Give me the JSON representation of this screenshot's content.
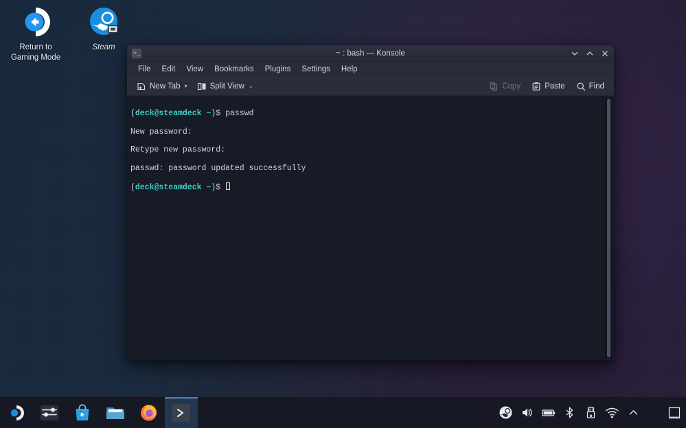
{
  "desktop": {
    "icons": [
      {
        "name": "return-to-gaming-mode",
        "label": "Return to\nGaming Mode",
        "label_line1": "Return to",
        "label_line2": "Gaming Mode",
        "icon": "return-arrow-icon",
        "accent": "#2196f3"
      },
      {
        "name": "steam",
        "label": "Steam",
        "icon": "steam-icon",
        "accent": "#1a9fff"
      }
    ]
  },
  "window": {
    "title": "~ : bash — Konsole",
    "app_icon": "konsole-prompt-icon",
    "controls": [
      {
        "name": "minimize",
        "icon": "chevron-down-icon",
        "label": "Minimize"
      },
      {
        "name": "maximize",
        "icon": "chevron-up-icon",
        "label": "Maximize"
      },
      {
        "name": "close",
        "icon": "close-x-icon",
        "label": "Close"
      }
    ],
    "menubar": [
      {
        "label": "File"
      },
      {
        "label": "Edit"
      },
      {
        "label": "View"
      },
      {
        "label": "Bookmarks"
      },
      {
        "label": "Plugins"
      },
      {
        "label": "Settings"
      },
      {
        "label": "Help"
      }
    ],
    "toolbar": {
      "new_tab_label": "New Tab",
      "split_view_label": "Split View",
      "copy_label": "Copy",
      "copy_enabled": false,
      "paste_label": "Paste",
      "find_label": "Find"
    }
  },
  "terminal": {
    "background": "#171b26",
    "foreground": "#cfd4de",
    "prompt_color": "#3fd0c9",
    "lines": [
      {
        "type": "prompt",
        "user_host": "deck@steamdeck",
        "cwd": "~",
        "sigil": "$",
        "command": "passwd"
      },
      {
        "type": "text",
        "text": "New password:"
      },
      {
        "type": "text",
        "text": "Retype new password:"
      },
      {
        "type": "text",
        "text": "passwd: password updated successfully"
      },
      {
        "type": "prompt",
        "user_host": "deck@steamdeck",
        "cwd": "~",
        "sigil": "$",
        "command": "",
        "cursor": true
      }
    ]
  },
  "taskbar": {
    "tasks": [
      {
        "name": "application-launcher",
        "icon": "steamos-launcher-icon",
        "label": "Application Launcher",
        "active": false
      },
      {
        "name": "system-settings",
        "icon": "sliders-icon",
        "label": "System Settings",
        "active": false
      },
      {
        "name": "discover",
        "icon": "discover-bag-icon",
        "label": "Discover",
        "active": false
      },
      {
        "name": "file-manager",
        "icon": "folder-icon",
        "label": "Dolphin",
        "active": false
      },
      {
        "name": "firefox",
        "icon": "firefox-icon",
        "label": "Firefox",
        "active": false
      },
      {
        "name": "konsole",
        "icon": "konsole-prompt-icon",
        "label": "Konsole",
        "active": true
      }
    ],
    "tray": [
      {
        "name": "steam-tray",
        "icon": "steam-icon",
        "label": "Steam"
      },
      {
        "name": "volume",
        "icon": "speaker-icon",
        "label": "Volume"
      },
      {
        "name": "battery",
        "icon": "battery-icon",
        "label": "Battery"
      },
      {
        "name": "bluetooth",
        "icon": "bluetooth-icon",
        "label": "Bluetooth"
      },
      {
        "name": "removable-media",
        "icon": "usb-drive-icon",
        "label": "Removable Devices"
      },
      {
        "name": "network",
        "icon": "wifi-icon",
        "label": "Networks"
      },
      {
        "name": "show-hidden",
        "icon": "chevron-up-icon",
        "label": "Show hidden icons"
      }
    ],
    "show_desktop_label": "Show Desktop",
    "show_desktop_icon": "show-desktop-icon"
  }
}
